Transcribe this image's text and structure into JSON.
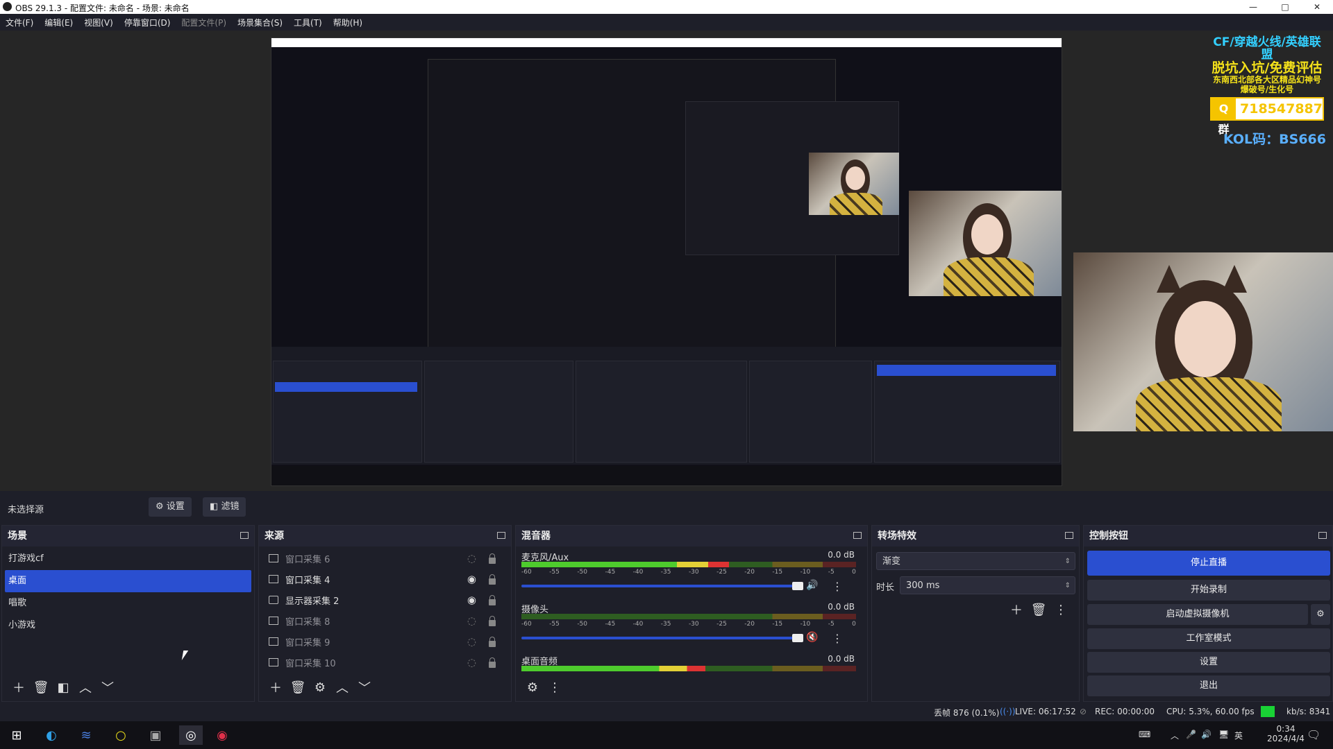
{
  "title_bar": {
    "text": "OBS 29.1.3 - 配置文件: 未命名 - 场景: 未命名",
    "controls": [
      "—",
      "□",
      "✕"
    ]
  },
  "menu": [
    "文件(F)",
    "编辑(E)",
    "视图(V)",
    "停靠窗口(D)",
    "配置文件(P)",
    "场景集合(S)",
    "工具(T)",
    "帮助(H)"
  ],
  "overlay": {
    "line1": "CF/穿越火线/英雄联盟",
    "line2": "脱坑入坑/免费评估",
    "line3": "东南西北部各大区精品幻神号",
    "line4": "爆破号/生化号",
    "qq_label": "Q群",
    "qq_number": "718547887",
    "kol": "KOL码：BS666"
  },
  "source_bar": {
    "selected": "未选择源",
    "settings": "设置",
    "filters": "滤镜"
  },
  "scenes": {
    "title": "场景",
    "items": [
      "打游戏cf",
      "桌面",
      "唱歌",
      "小游戏"
    ],
    "active_index": 1
  },
  "sources": {
    "title": "来源",
    "items": [
      {
        "name": "窗口采集 6",
        "visible": false,
        "type": "window"
      },
      {
        "name": "窗口采集 4",
        "visible": true,
        "type": "window"
      },
      {
        "name": "显示器采集 2",
        "visible": true,
        "type": "monitor"
      },
      {
        "name": "窗口采集 8",
        "visible": false,
        "type": "window"
      },
      {
        "name": "窗口采集 9",
        "visible": false,
        "type": "window"
      },
      {
        "name": "窗口采集 10",
        "visible": false,
        "type": "window"
      }
    ]
  },
  "mixer": {
    "title": "混音器",
    "scale": [
      "-60",
      "-55",
      "-50",
      "-45",
      "-40",
      "-35",
      "-30",
      "-25",
      "-20",
      "-15",
      "-10",
      "-5",
      "0"
    ],
    "channels": [
      {
        "name": "麦克风/Aux",
        "db": "0.0 dB",
        "level": 0.62,
        "muted": false
      },
      {
        "name": "摄像头",
        "db": "0.0 dB",
        "level": 0.0,
        "muted": true
      },
      {
        "name": "桌面音频",
        "db": "0.0 dB",
        "level": 0.55,
        "muted": false
      }
    ]
  },
  "transitions": {
    "title": "转场特效",
    "type": "渐变",
    "duration_label": "时长",
    "duration": "300 ms"
  },
  "controls": {
    "title": "控制按钮",
    "stop_stream": "停止直播",
    "start_record": "开始录制",
    "virtual_cam": "启动虚拟摄像机",
    "studio_mode": "工作室模式",
    "settings": "设置",
    "exit": "退出"
  },
  "status": {
    "dropped": "丢帧 876 (0.1%)",
    "live": "LIVE: 06:17:52",
    "rec": "REC: 00:00:00",
    "cpu": "CPU: 5.3%, 60.00 fps",
    "kbs": "kb/s: 8341"
  },
  "taskbar": {
    "time": "0:34",
    "date": "2024/4/4",
    "lang": "英"
  },
  "colors": {
    "accent": "#2a4fd0",
    "live_green": "#19d235",
    "overlay_yellow": "#f5e21a",
    "overlay_cyan": "#33d0ff"
  }
}
